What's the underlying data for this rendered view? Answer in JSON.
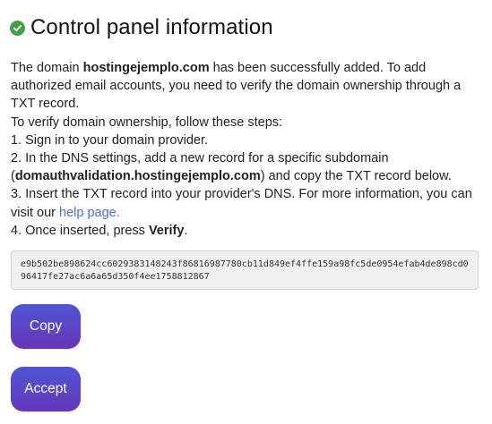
{
  "header": {
    "title": "Control panel information",
    "icon": "check-circle-icon",
    "icon_color": "#43a047"
  },
  "intro": {
    "prefix": "The domain ",
    "domain": "hostingejemplo.com",
    "suffix": " has been successfully added. To add authorized email accounts, you need to verify the domain ownership through a TXT record."
  },
  "steps_heading": "To verify domain ownership, follow these steps:",
  "steps": {
    "step1": "1. Sign in to your domain provider.",
    "step2_prefix": "2. In the DNS settings, add a new record for a specific subdomain (",
    "step2_subdomain": "domauthvalidation.hostingejemplo.com",
    "step2_suffix": ") and copy the TXT record below.",
    "step3_prefix": "3. Insert the TXT record into your provider's DNS. For more information, you can visit our ",
    "step3_link": "help page.",
    "step4_prefix": "4. Once inserted, press ",
    "step4_bold": "Verify",
    "step4_suffix": "."
  },
  "txt_record": "e9b502be898624cc6029383148243f86816987780cb11d849ef4ffe159a98fc5de0954efab4de898cd096417fe27ac6a6a65d350f4ee1758812867",
  "buttons": {
    "copy_label": "Copy",
    "accept_label": "Accept"
  },
  "colors": {
    "link": "#4c6fd8",
    "button_gradient_top": "#4e55d4",
    "button_gradient_bottom": "#6636b8"
  }
}
